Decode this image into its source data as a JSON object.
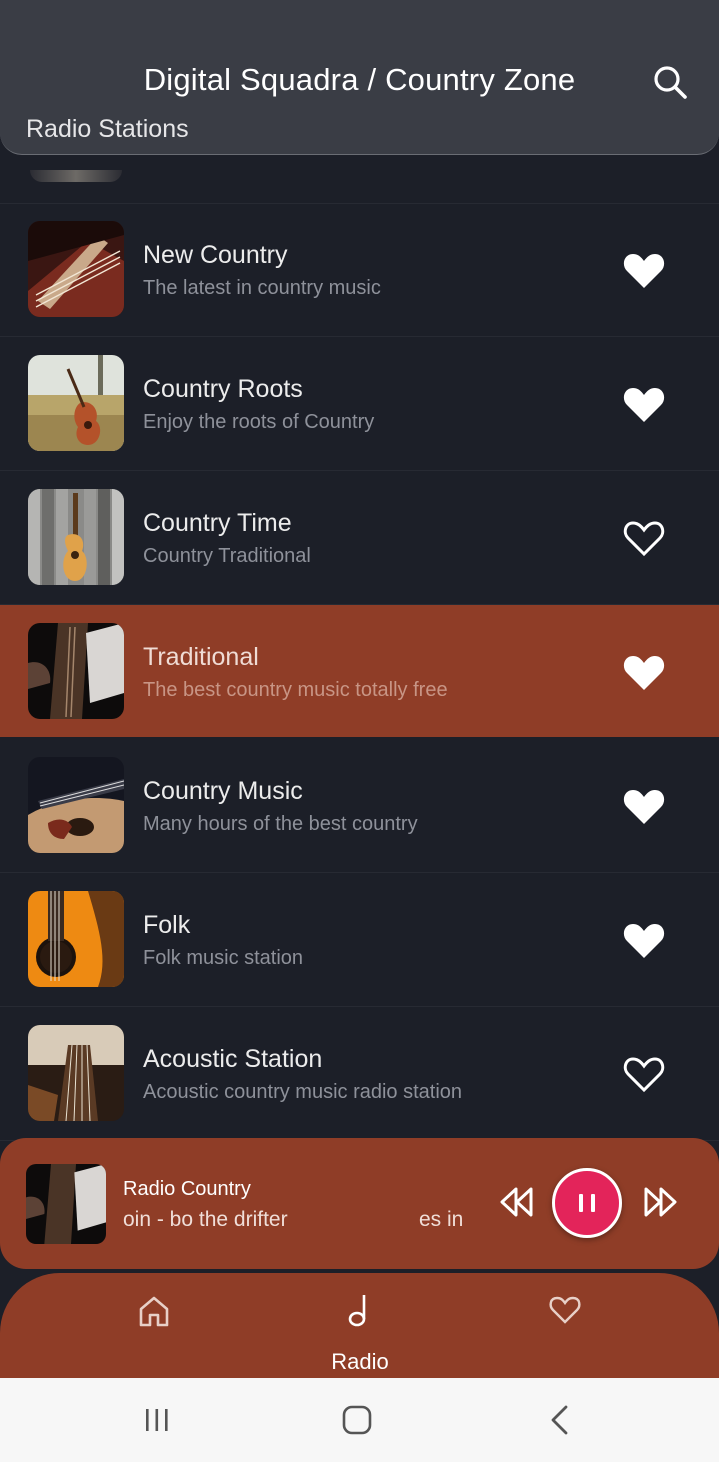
{
  "header": {
    "title": "Digital Squadra / Country Zone",
    "subtitle": "Radio Stations",
    "search_icon": "search-icon"
  },
  "stations": [
    {
      "title": "New Country",
      "subtitle": "The latest in country music",
      "favorite": true
    },
    {
      "title": "Country Roots",
      "subtitle": "Enjoy the roots of Country",
      "favorite": true
    },
    {
      "title": "Country Time",
      "subtitle": "Country Traditional",
      "favorite": false
    },
    {
      "title": "Traditional",
      "subtitle": "The best country music totally free",
      "favorite": true,
      "active": true
    },
    {
      "title": "Country Music",
      "subtitle": "Many hours of the best country",
      "favorite": true
    },
    {
      "title": "Folk",
      "subtitle": "Folk music station",
      "favorite": true
    },
    {
      "title": "Acoustic Station",
      "subtitle": "Acoustic country music radio station",
      "favorite": false
    }
  ],
  "player": {
    "title": "Radio Country",
    "now_playing_a": "oin - bo the drifter",
    "now_playing_b": "es in",
    "state": "playing",
    "icons": [
      "rewind-icon",
      "pause-icon",
      "fast-forward-icon"
    ]
  },
  "bottom_nav": {
    "items": [
      {
        "icon": "home-icon",
        "label": ""
      },
      {
        "icon": "music-note-icon",
        "label": "Radio",
        "selected": true
      },
      {
        "icon": "heart-icon",
        "label": ""
      }
    ]
  },
  "system_nav": {
    "icons": [
      "recents-icon",
      "home-circle-icon",
      "back-icon"
    ]
  },
  "colors": {
    "background": "#1c1f28",
    "header": "#3a3d45",
    "accent": "#8f3d27",
    "play_button": "#e3245a"
  }
}
